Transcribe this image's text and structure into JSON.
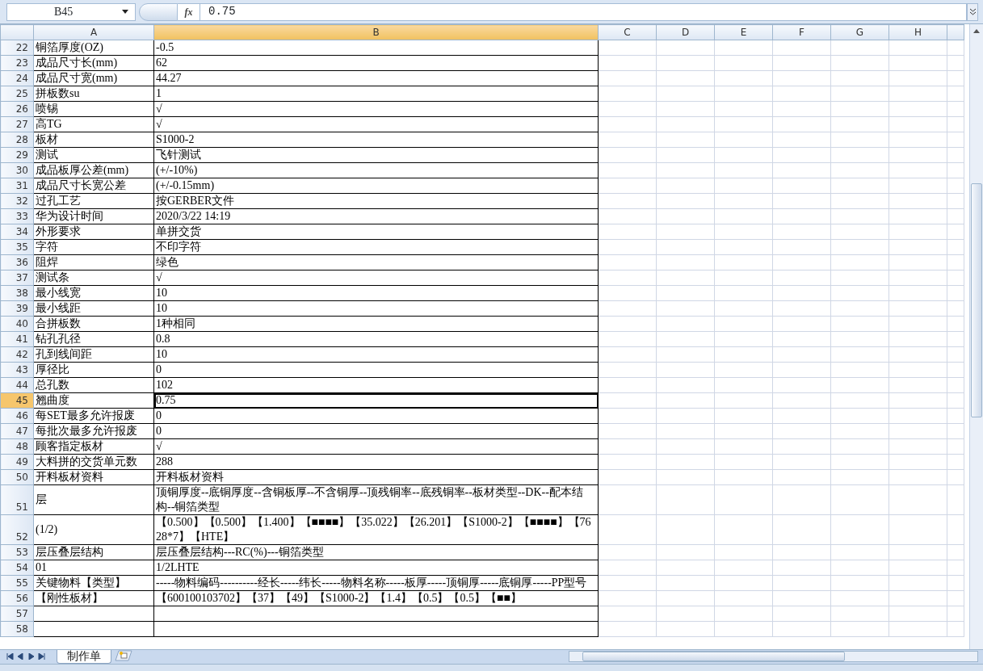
{
  "formula_bar": {
    "name_box": "B45",
    "fx_label": "fx",
    "value": "0.75"
  },
  "columns": [
    {
      "label": "A",
      "selected": false
    },
    {
      "label": "B",
      "selected": true
    },
    {
      "label": "C",
      "selected": false
    },
    {
      "label": "D",
      "selected": false
    },
    {
      "label": "E",
      "selected": false
    },
    {
      "label": "F",
      "selected": false
    },
    {
      "label": "G",
      "selected": false
    },
    {
      "label": "H",
      "selected": false
    }
  ],
  "rows": [
    {
      "number": "22",
      "a": "铜箔厚度(OZ)",
      "b": "-0.5",
      "selected": false
    },
    {
      "number": "23",
      "a": "成品尺寸长(mm)",
      "b": "62",
      "selected": false
    },
    {
      "number": "24",
      "a": "成品尺寸宽(mm)",
      "b": "44.27",
      "selected": false
    },
    {
      "number": "25",
      "a": "拼板数su",
      "b": "1",
      "selected": false
    },
    {
      "number": "26",
      "a": "喷锡",
      "b": "√",
      "selected": false
    },
    {
      "number": "27",
      "a": "高TG",
      "b": "√",
      "selected": false
    },
    {
      "number": "28",
      "a": "板材",
      "b": "S1000-2",
      "selected": false
    },
    {
      "number": "29",
      "a": "测试",
      "b": "飞针测试",
      "selected": false
    },
    {
      "number": "30",
      "a": "成品板厚公差(mm)",
      "b": "(+/-10%)",
      "selected": false
    },
    {
      "number": "31",
      "a": "成品尺寸长宽公差",
      "b": "(+/-0.15mm)",
      "selected": false
    },
    {
      "number": "32",
      "a": "过孔工艺",
      "b": "按GERBER文件",
      "selected": false
    },
    {
      "number": "33",
      "a": "华为设计时间",
      "b": "2020/3/22 14:19",
      "selected": false
    },
    {
      "number": "34",
      "a": "外形要求",
      "b": "单拼交货",
      "selected": false
    },
    {
      "number": "35",
      "a": "字符",
      "b": "不印字符",
      "selected": false
    },
    {
      "number": "36",
      "a": "阻焊",
      "b": "绿色",
      "selected": false
    },
    {
      "number": "37",
      "a": "测试条",
      "b": "√",
      "selected": false
    },
    {
      "number": "38",
      "a": "最小线宽",
      "b": "10",
      "selected": false
    },
    {
      "number": "39",
      "a": "最小线距",
      "b": "10",
      "selected": false
    },
    {
      "number": "40",
      "a": "合拼板数",
      "b": "1种相同",
      "selected": false
    },
    {
      "number": "41",
      "a": "钻孔孔径",
      "b": "0.8",
      "selected": false
    },
    {
      "number": "42",
      "a": "孔到线间距",
      "b": "10",
      "selected": false
    },
    {
      "number": "43",
      "a": "厚径比",
      "b": "0",
      "selected": false
    },
    {
      "number": "44",
      "a": "总孔数",
      "b": "102",
      "selected": false
    },
    {
      "number": "45",
      "a": "翘曲度",
      "b": "0.75",
      "selected": true
    },
    {
      "number": "46",
      "a": "每SET最多允许报废",
      "b": "0",
      "selected": false
    },
    {
      "number": "47",
      "a": "每批次最多允许报废",
      "b": "0",
      "selected": false
    },
    {
      "number": "48",
      "a": "顾客指定板材",
      "b": "√",
      "selected": false
    },
    {
      "number": "49",
      "a": "大料拼的交货单元数",
      "b": "288",
      "selected": false
    },
    {
      "number": "50",
      "a": "开料板材资料",
      "b": "开料板材资料",
      "selected": false
    },
    {
      "number": "51",
      "a": "层",
      "b": "顶铜厚度--底铜厚度--含铜板厚--不含铜厚--顶残铜率--底残铜率--板材类型--DK--配本结构--铜箔类型",
      "selected": false
    },
    {
      "number": "52",
      "a": "(1/2)",
      "b": "【0.500】【0.500】【1.400】【■■■■】【35.022】【26.201】【S1000-2】【■■■■】【7628*7】【HTE】",
      "selected": false
    },
    {
      "number": "53",
      "a": "层压叠层结构",
      "b": "层压叠层结构---RC(%)---铜箔类型",
      "selected": false
    },
    {
      "number": "54",
      "a": "01",
      "b": "1/2LHTE",
      "selected": false
    },
    {
      "number": "55",
      "a": "关键物料【类型】",
      "b": "-----物料编码----------经长-----纬长-----物料名称-----板厚-----顶铜厚-----底铜厚-----PP型号",
      "selected": false
    },
    {
      "number": "56",
      "a": "【刚性板材】",
      "b": "【600100103702】【37】【49】【S1000-2】【1.4】【0.5】【0.5】【■■】",
      "selected": false
    },
    {
      "number": "57",
      "selected": false
    },
    {
      "number": "58",
      "selected": false
    }
  ],
  "sheet_tabs": [
    {
      "label": "制作单",
      "selected": true
    }
  ]
}
